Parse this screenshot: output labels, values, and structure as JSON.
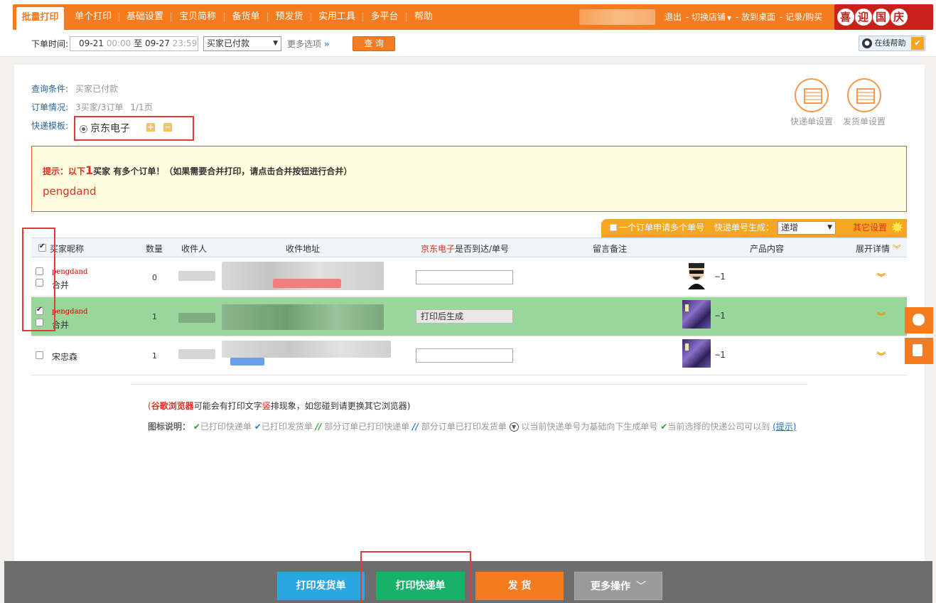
{
  "nav": {
    "tabs": [
      {
        "label": "批量打印"
      },
      {
        "label": "单个打印"
      },
      {
        "label": "基础设置"
      },
      {
        "label": "宝贝简称"
      },
      {
        "label": "备货单"
      },
      {
        "label": "预发货"
      },
      {
        "label": "实用工具"
      },
      {
        "label": "多平台"
      },
      {
        "label": "帮助"
      }
    ],
    "logout": "退出",
    "switch_shop": "切换店铺",
    "to_desktop": "放到桌面",
    "records": "记录/购买",
    "banner": {
      "c1": "喜",
      "c2": "迎",
      "c3": "国",
      "c4": "庆"
    }
  },
  "search": {
    "order_time_label": "下单时间:",
    "date_from": "09-21",
    "time_from": "00:00",
    "to": "至",
    "date_to": "09-27",
    "time_to": "23:59",
    "status_value": "买家已付款",
    "more_options": "更多选项",
    "more_arrows": "»",
    "query_button": "查 询",
    "online_help": "在线帮助"
  },
  "conditions": {
    "query_label": "查询条件:",
    "query_value": "买家已付款",
    "orders_label": "订单情况:",
    "orders_value": "3买家/3订单",
    "page_value": "1/1页",
    "template_label": "快递模板:",
    "template_value": "京东电子",
    "plus": "+",
    "minus": "−"
  },
  "settings": {
    "express_label": "快递单设置",
    "delivery_label": "发货单设置"
  },
  "tip": {
    "prefix": "提示：以下",
    "count": "1",
    "text": "买家 有多个订单！（如果需要合并打印，请点击合并按钮进行合并）",
    "buyer": "pengdand"
  },
  "options": {
    "multi_label": "一个订单申请多个单号",
    "gen_label": "快递单号生成：",
    "gen_value": "递增",
    "other_settings": "其它设置"
  },
  "table": {
    "headers": {
      "nickname": "买家昵称",
      "qty": "数量",
      "recipient": "收件人",
      "address": "收件地址",
      "express_name": "京东电子",
      "express_suffix": "是否到达/单号",
      "remark": "留言备注",
      "product": "产品内容",
      "expand": "展开详情"
    },
    "rows": [
      {
        "nickname": "pengdand",
        "merge": "合并",
        "qty": "0",
        "waybill": "",
        "product_count": "−1"
      },
      {
        "nickname": "pengdand",
        "merge": "合并",
        "qty": "1",
        "waybill": "打印后生成",
        "product_count": "−1"
      },
      {
        "nickname": "宋忠森",
        "merge": "",
        "qty": "1",
        "waybill": "",
        "product_count": "−1"
      }
    ]
  },
  "notes": {
    "warn_open": "(",
    "warn_browser": "谷歌浏览器",
    "warn_mid": "可能会有打印文字",
    "warn_vertical": "竖",
    "warn_rest": "排现象，如您碰到请更换其它浏览器)",
    "legend_label": "图标说明：",
    "l1": "已打印快递单",
    "l2": "已打印发货单",
    "l3": "部分订单已打印快递单",
    "l4": "部分订单已打印发货单",
    "l5": "以当前快递单号为基础向下生成单号",
    "l6": "当前选择的快递公司可以到",
    "l_link": "(提示)"
  },
  "bottom": {
    "print_delivery": "打印发货单",
    "print_express": "打印快递单",
    "ship": "发 货",
    "more_ops": "更多操作"
  },
  "colors": {
    "brand": "#f47b20",
    "selected_row": "#99d69a",
    "highlight_box": "#e23b3b"
  }
}
